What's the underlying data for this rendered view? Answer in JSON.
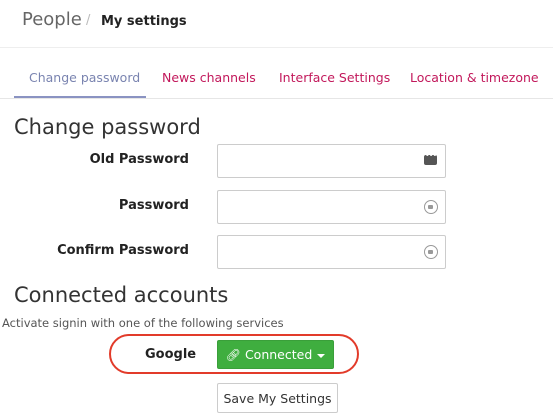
{
  "breadcrumb": {
    "root": "People",
    "separator": "/",
    "current": "My settings"
  },
  "tabs": [
    {
      "label": "Change password",
      "active": true
    },
    {
      "label": "News channels",
      "active": false
    },
    {
      "label": "Interface Settings",
      "active": false
    },
    {
      "label": "Location & timezone",
      "active": false
    }
  ],
  "change_password": {
    "heading": "Change password",
    "fields": [
      {
        "label": "Old Password",
        "value": "",
        "icon": "key-icon"
      },
      {
        "label": "Password",
        "value": "",
        "icon": "lock-icon"
      },
      {
        "label": "Confirm Password",
        "value": "",
        "icon": "lock-icon"
      }
    ]
  },
  "connected_accounts": {
    "heading": "Connected accounts",
    "description": "Activate signin with one of the following services",
    "services": [
      {
        "name": "Google",
        "status_label": "Connected",
        "icon": "link-icon"
      }
    ]
  },
  "actions": {
    "save_label": "Save My Settings"
  },
  "colors": {
    "connected_green": "#3fae3f",
    "tab_link": "#c2185b",
    "tab_active": "#7a84b0",
    "highlight_outline": "#e23b2a"
  }
}
